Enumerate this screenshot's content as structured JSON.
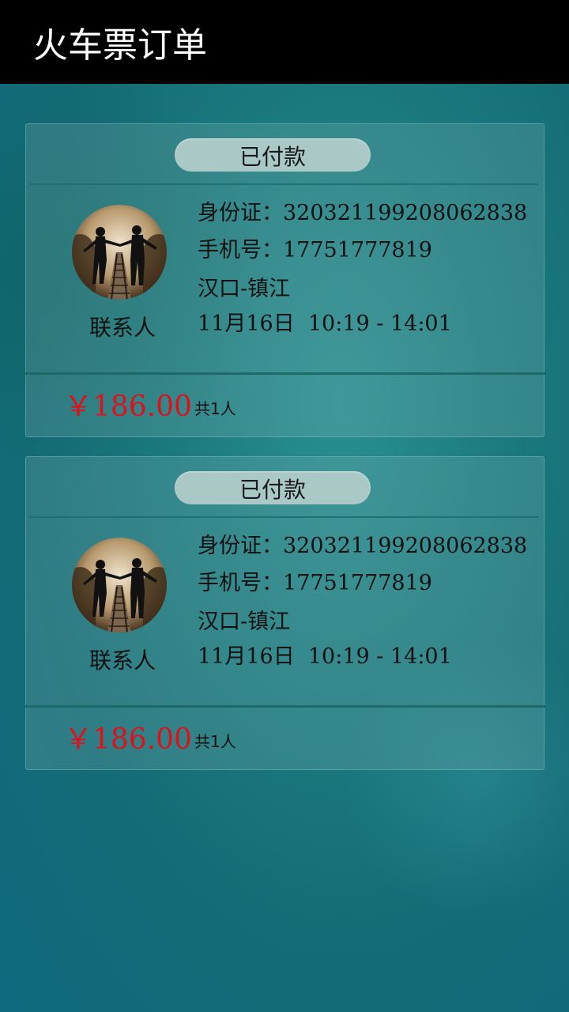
{
  "header": {
    "title": "火车票订单"
  },
  "orders": [
    {
      "status": "已付款",
      "contact_label": "联系人",
      "id_label": "身份证：",
      "id_number": "320321199208062838",
      "phone_label": "手机号：",
      "phone": "17751777819",
      "route": "汉口-镇江",
      "schedule": "11月16日  10:19 - 14:01",
      "price": "￥186.00",
      "passenger_count": "共1人"
    },
    {
      "status": "已付款",
      "contact_label": "联系人",
      "id_label": "身份证：",
      "id_number": "320321199208062838",
      "phone_label": "手机号：",
      "phone": "17751777819",
      "route": "汉口-镇江",
      "schedule": "11月16日  10:19 - 14:01",
      "price": "￥186.00",
      "passenger_count": "共1人"
    }
  ],
  "colors": {
    "title_bar": "#000000",
    "price": "#e0101a",
    "status_pill": "#a9c8c6"
  },
  "icons": {
    "avatar": "couple-on-railway-photo"
  }
}
